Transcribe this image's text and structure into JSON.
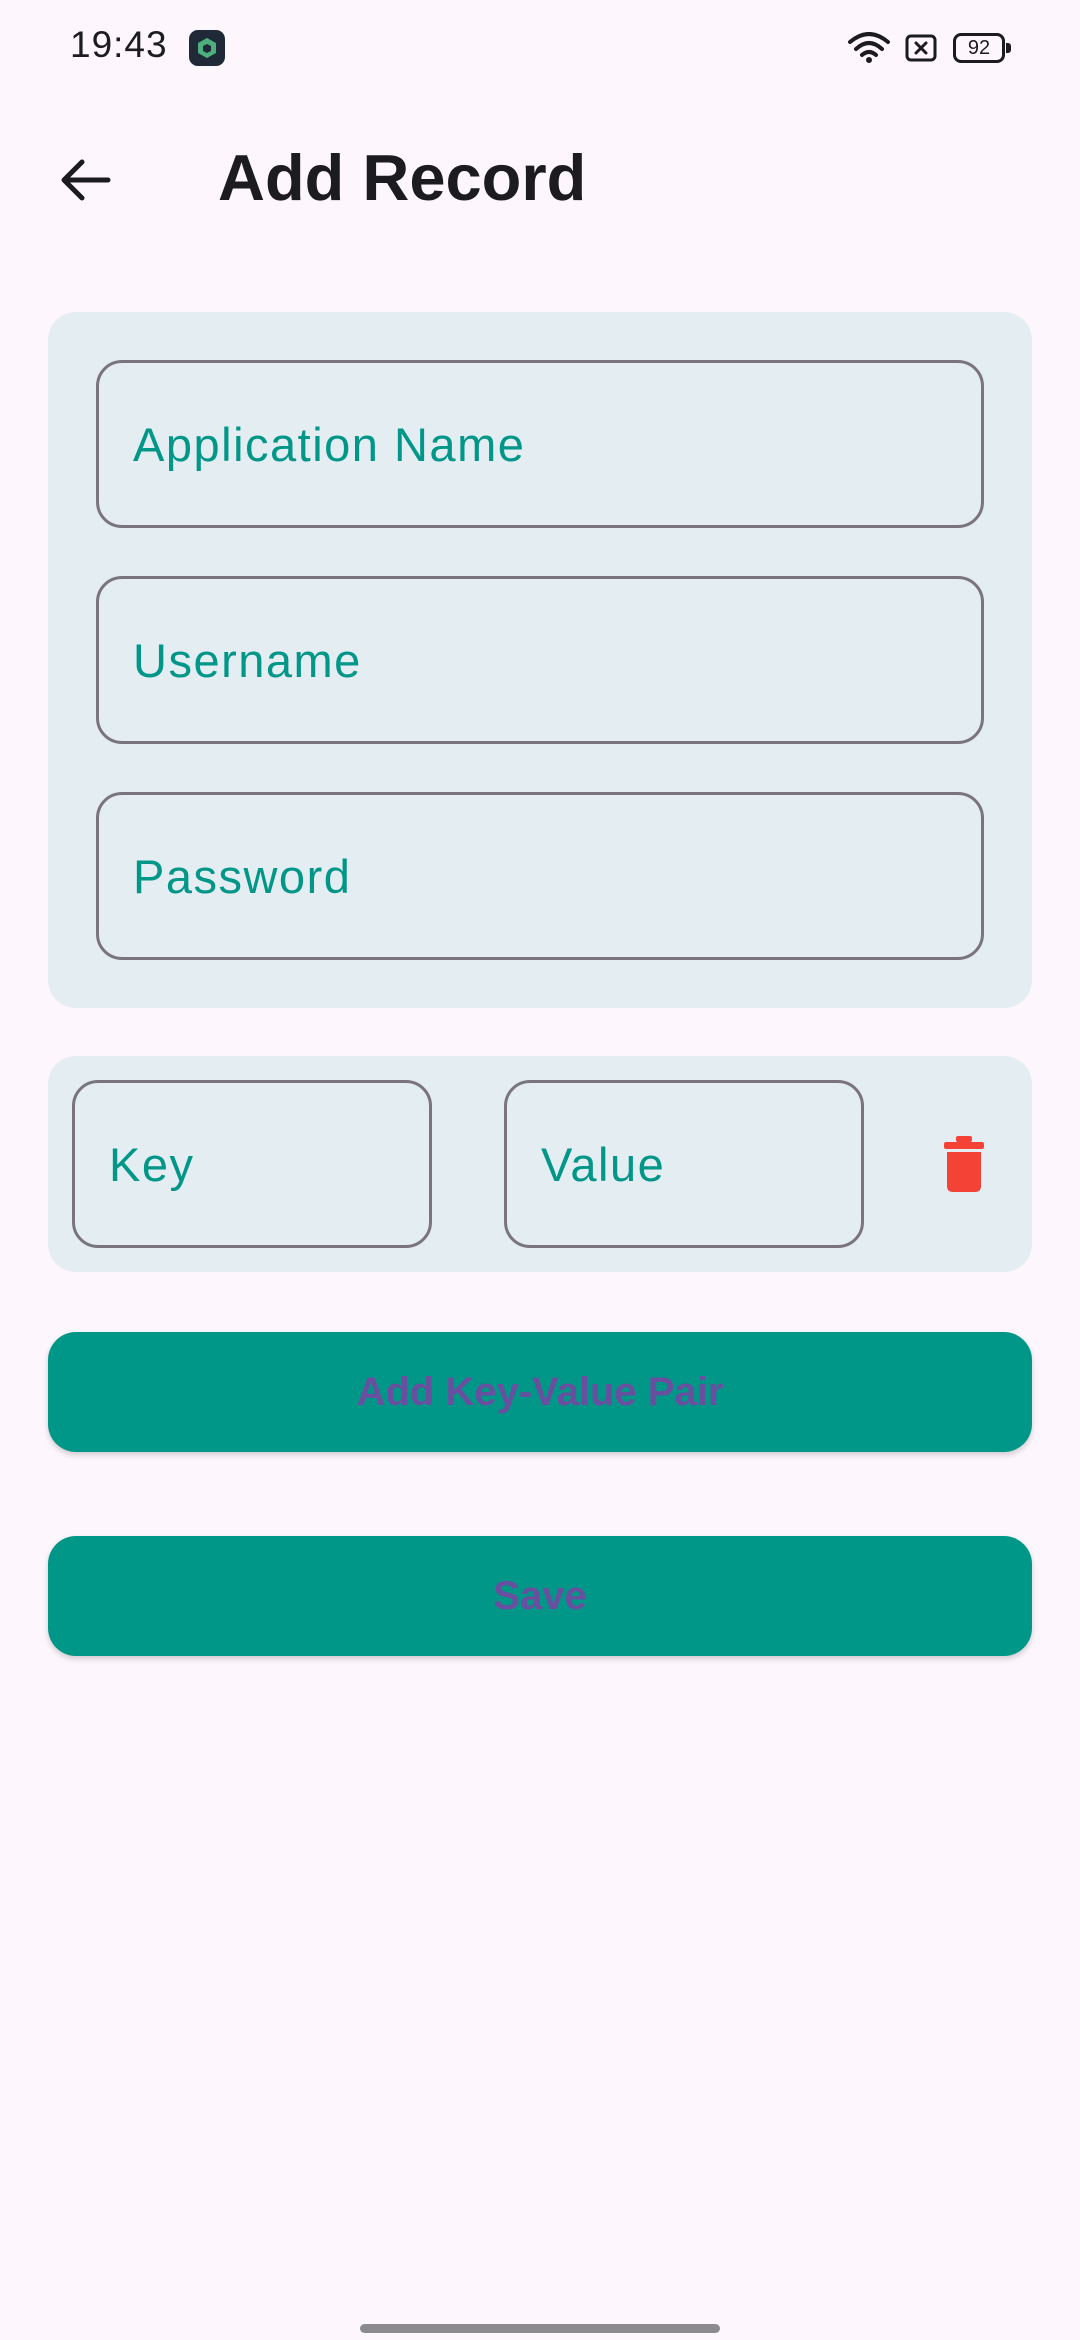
{
  "status_bar": {
    "time": "19:43",
    "battery": "92",
    "icons": [
      "app-notification-icon",
      "wifi-icon",
      "sim-off-icon",
      "battery-icon"
    ]
  },
  "app_bar": {
    "title": "Add Record",
    "back_icon": "arrow-back-icon"
  },
  "form": {
    "application_name": {
      "label": "Application Name",
      "value": ""
    },
    "username": {
      "label": "Username",
      "value": ""
    },
    "password": {
      "label": "Password",
      "value": ""
    }
  },
  "key_value_pairs": [
    {
      "key_label": "Key",
      "value_label": "Value",
      "delete_icon": "trash-icon"
    }
  ],
  "buttons": {
    "add_pair": "Add Key-Value Pair",
    "save": "Save"
  },
  "colors": {
    "accent": "#009688",
    "card_background": "#e3edf2",
    "page_background": "#fdf7fd",
    "button_text": "#6a4fa0",
    "delete": "#f44336",
    "outline": "#79747e"
  }
}
